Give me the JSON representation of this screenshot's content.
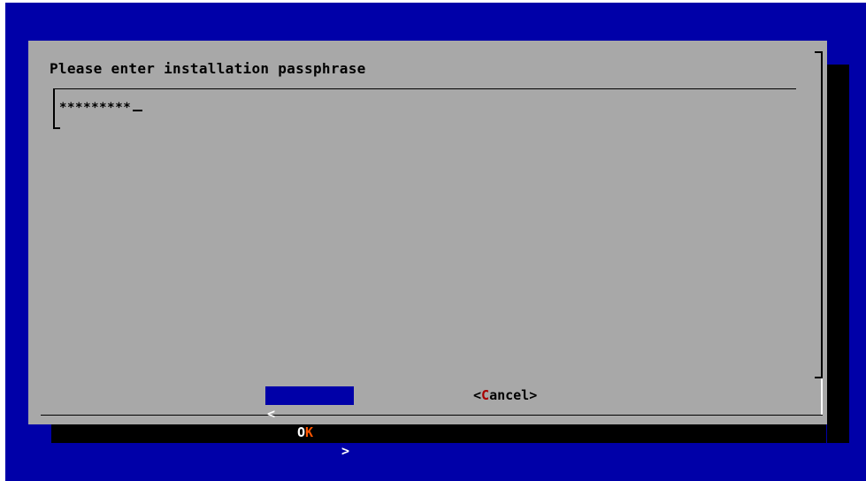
{
  "colors": {
    "screen_background": "#0000a8",
    "dialog_background": "#a8a8a8",
    "selected_button_background": "#0000a8",
    "hotkey_selected": "#ff5500",
    "hotkey_unselected": "#a80000"
  },
  "dialog": {
    "prompt": "Please enter installation passphrase",
    "input": {
      "value": "*********"
    },
    "buttons": {
      "ok": {
        "left_bracket": "<",
        "hotkey_prefix": "O",
        "hotkey": "K",
        "right_bracket": ">"
      },
      "cancel": {
        "open": "<",
        "hotkey": "C",
        "rest": "ancel",
        "close": ">"
      }
    }
  }
}
